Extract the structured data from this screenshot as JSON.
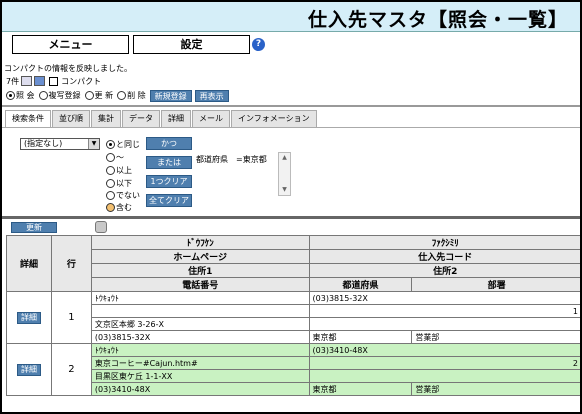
{
  "header": {
    "title": "仕入先マスタ【照会・一覧】"
  },
  "toolbar": {
    "menu_label": "メニュー",
    "settings_label": "設定",
    "help_symbol": "?"
  },
  "message": "コンパクトの情報を反映しました。",
  "count": {
    "label": "7件",
    "compact_label": "コンパクト"
  },
  "modes": [
    {
      "label": "照 会",
      "selected": true
    },
    {
      "label": "複写登録",
      "selected": false
    },
    {
      "label": "更 新",
      "selected": false
    },
    {
      "label": "削 除",
      "selected": false
    }
  ],
  "mode_buttons": {
    "new_label": "新規登録",
    "redisplay_label": "再表示"
  },
  "tabs": [
    "検索条件",
    "並び順",
    "集計",
    "データ",
    "詳細",
    "メール",
    "インフォメーション"
  ],
  "search": {
    "field_select": "(指定なし)",
    "conditions": [
      "と同じ",
      "～",
      "以上",
      "以下",
      "でない",
      "含む"
    ],
    "buttons": {
      "and_label": "かつ",
      "or_label": "または",
      "clear_one_label": "1つクリア",
      "clear_all_label": "全てクリア"
    },
    "current_condition": "都道府県　=東京都"
  },
  "list": {
    "update_label": "更新",
    "headers": {
      "detail": "詳細",
      "row": "行",
      "kana": "ﾄﾞｳﾌｹﾝ",
      "fax": "ﾌｧｸｼﾐﾘ",
      "homepage": "ホームページ",
      "supplier_code": "仕入先コード",
      "address1": "住所1",
      "address2": "住所2",
      "phone": "電話番号",
      "prefecture": "都道府県",
      "department": "部署"
    },
    "rows": [
      {
        "detail_label": "詳細",
        "row_no": "1",
        "kana": "ﾄｳｷｮｳﾄ",
        "fax": "(03)3815-32X",
        "homepage": "",
        "supplier_code": "1",
        "address1": "文京区本郷 3-26-X",
        "address2": "",
        "phone": "(03)3815-32X",
        "prefecture": "東京都",
        "department": "営業部"
      },
      {
        "detail_label": "詳細",
        "row_no": "2",
        "kana": "ﾄｳｷｮｳﾄ",
        "fax": "(03)3410-48X",
        "homepage": "東京コーヒー#Cajun.htm#",
        "supplier_code": "2",
        "address1": "目黒区東ケ丘 1-1-XX",
        "address2": "",
        "phone": "(03)3410-48X",
        "prefecture": "東京都",
        "department": "営業部"
      }
    ]
  },
  "colors": {
    "title_bg": "#d5eef8",
    "button_blue": "#4f7fae",
    "row_green": "#c9f2c2"
  }
}
